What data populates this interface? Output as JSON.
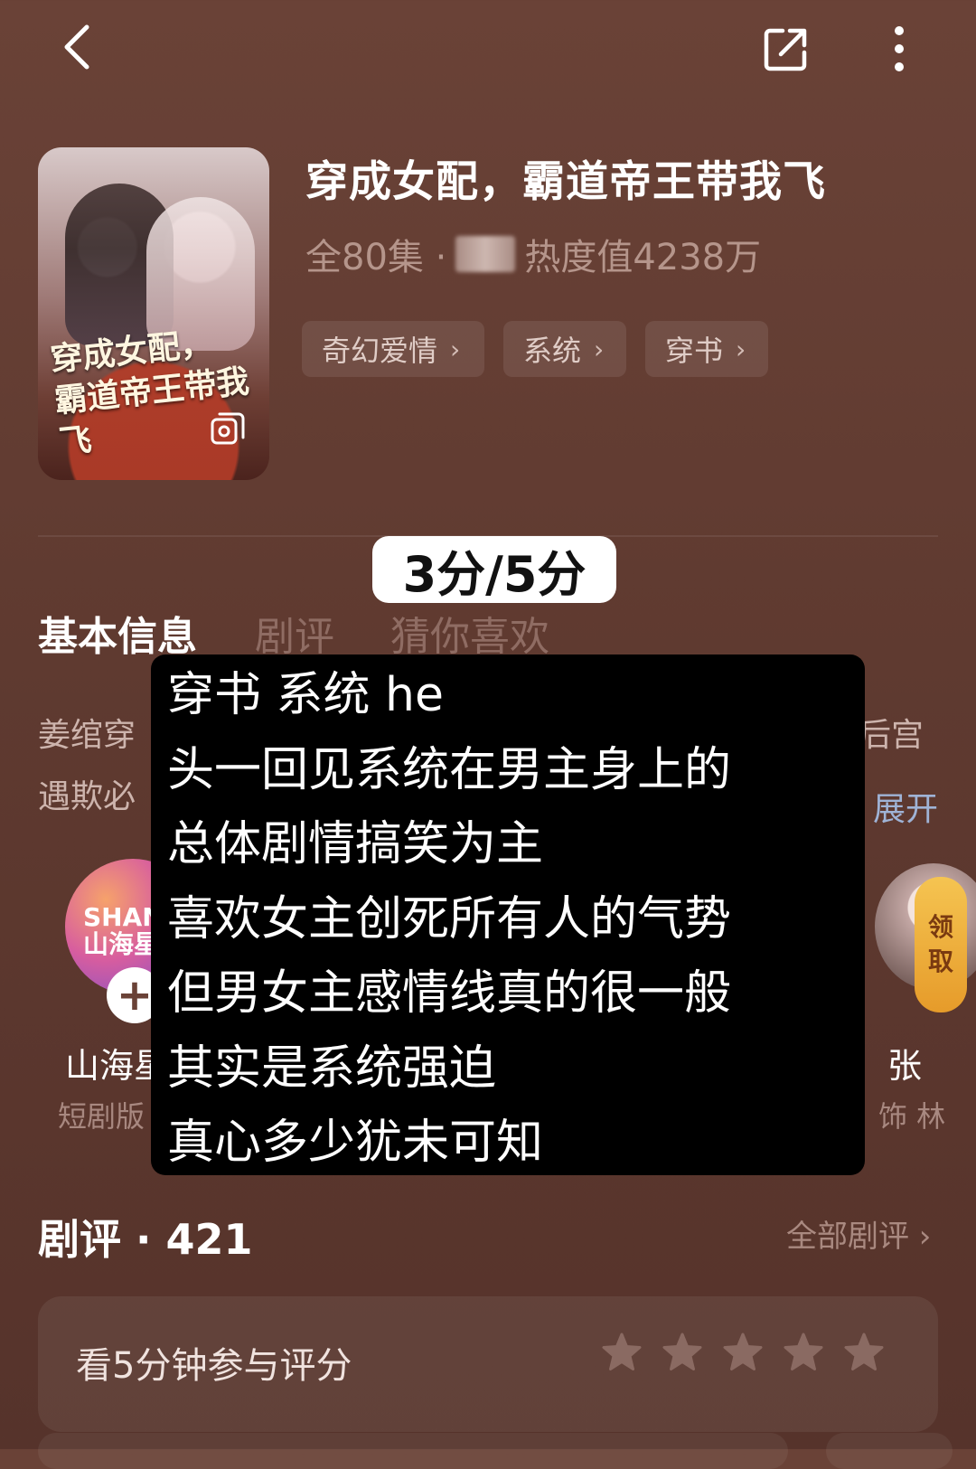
{
  "header": {
    "back_icon": "back-arrow-icon",
    "share_icon": "share-icon",
    "more_icon": "more-vertical-icon"
  },
  "drama": {
    "poster_title_line1": "穿成女配，",
    "poster_title_line2": "霸道帝王带我飞",
    "title": "穿成女配，霸道帝王带我飞",
    "episodes": "全80集 ·",
    "heat": "热度值4238万",
    "tags": [
      {
        "label": "奇幻爱情"
      },
      {
        "label": "系统"
      },
      {
        "label": "穿书"
      }
    ]
  },
  "rating_overlay": "3分/5分",
  "tabs": [
    {
      "label": "基本信息"
    },
    {
      "label": "剧评"
    },
    {
      "label": "猜你喜欢"
    }
  ],
  "synopsis": {
    "line1_start": "姜绾穿",
    "line1_end": "后宫",
    "line2_start": "遇欺必",
    "expand": "展开"
  },
  "cast": {
    "left_logo_line1": "SHAN",
    "left_logo_line2": "山海星",
    "left_name": "山海星",
    "left_role": "短剧版",
    "right_name": "张",
    "right_role": "饰 林",
    "claim_line1": "领",
    "claim_line2": "取"
  },
  "note_lines": [
    "穿书 系统 he",
    "头一回见系统在男主身上的",
    "总体剧情搞笑为主",
    "喜欢女主创死所有人的气势",
    "但男女主感情线真的很一般",
    "其实是系统强迫",
    "真心多少犹未可知"
  ],
  "reviews": {
    "title": "剧评 · 421",
    "all_link": "全部剧评 ›",
    "rate_prompt": "看5分钟参与评分",
    "star_count": 5,
    "star_color": "#8a6a62"
  }
}
